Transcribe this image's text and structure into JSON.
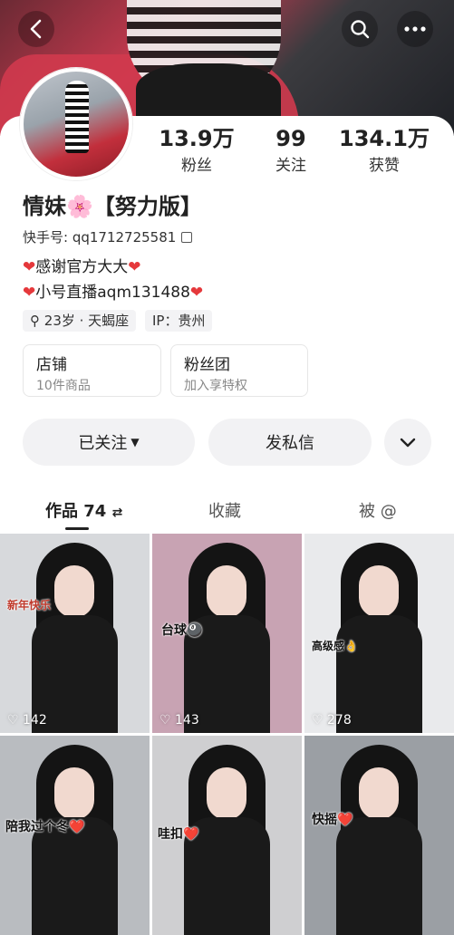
{
  "header": {
    "back_icon": "chevron-left-icon",
    "search_icon": "search-icon",
    "more_icon": "more-icon"
  },
  "stats": [
    {
      "value": "13.9万",
      "label": "粉丝"
    },
    {
      "value": "99",
      "label": "关注"
    },
    {
      "value": "134.1万",
      "label": "获赞"
    }
  ],
  "profile": {
    "name_pre": "情妹",
    "name_emoji": "🌸",
    "name_post": "【努力版】",
    "kuaishou_id": "快手号: qq1712725581",
    "bio_line1": "感谢官方大大",
    "bio_line2": "小号直播aqm131488",
    "tag_age": "23岁 · 天蝎座",
    "tag_ip": "IP：贵州"
  },
  "boxes": [
    {
      "title": "店铺",
      "sub": "10件商品"
    },
    {
      "title": "粉丝团",
      "sub": "加入享特权"
    }
  ],
  "actions": {
    "follow": "已关注",
    "message": "发私信"
  },
  "tabs": {
    "works": "作品 74",
    "collect": "收藏",
    "at": "被 @"
  },
  "videos": [
    {
      "likes": "142",
      "caption": "新年快乐",
      "bg": "#d7d9dc"
    },
    {
      "likes": "143",
      "caption": "台球🎱",
      "bg": "#c8a3b3"
    },
    {
      "likes": "278",
      "caption": "高级感👌",
      "bg": "#e9eaec"
    },
    {
      "likes": "",
      "caption": "陪我过个冬❤️",
      "bg": "#b9bcc0"
    },
    {
      "likes": "",
      "caption": "哇扣❤️",
      "bg": "#cfcfd1"
    },
    {
      "likes": "",
      "caption": "快摇❤️",
      "bg": "#9b9fa4"
    }
  ],
  "colors": {
    "accent_heart": "#e5383b"
  }
}
